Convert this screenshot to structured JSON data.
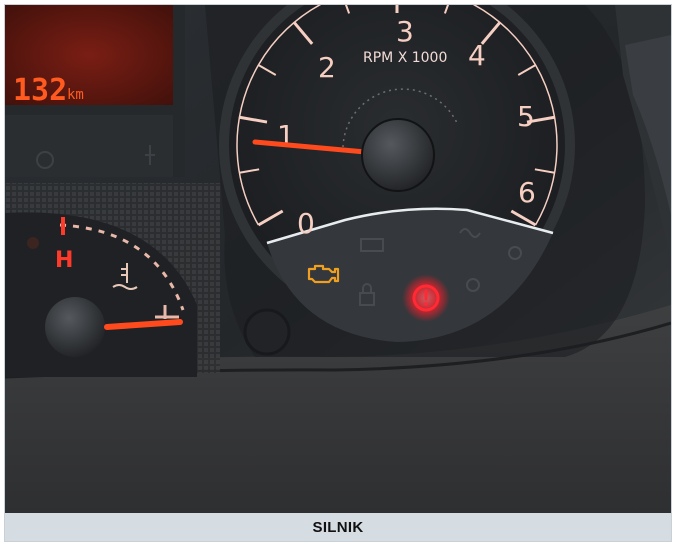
{
  "caption": "SILNIK",
  "odometer": {
    "value": "132",
    "unit": "km"
  },
  "tachometer": {
    "label": "RPM X 1000",
    "scale": [
      "0",
      "1",
      "2",
      "3",
      "4",
      "5",
      "6"
    ],
    "reading": 1
  },
  "temperature_gauge": {
    "high_mark": "H",
    "level": 0.05
  },
  "warning_lights": [
    {
      "icon": "check-engine-icon",
      "color": "#f0a020",
      "state": "on"
    },
    {
      "icon": "stop-warning-icon",
      "color": "#ff1e2a",
      "state": "on"
    }
  ]
}
